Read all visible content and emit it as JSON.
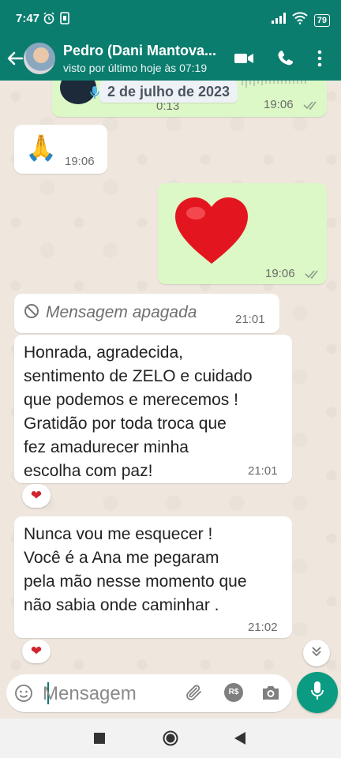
{
  "status_bar": {
    "time": "7:47",
    "battery": "79"
  },
  "header": {
    "contact_name": "Pedro (Dani Mantova...",
    "last_seen": "visto por último hoje às 07:19"
  },
  "chat": {
    "date_chip": "2 de julho de 2023",
    "top_bubble": {
      "duration": "0:13",
      "time": "19:06"
    },
    "messages": [
      {
        "emoji": "🙏",
        "time": "19:06"
      },
      {
        "emoji": "❤️",
        "time": "19:06"
      },
      {
        "deleted_text": "Mensagem apagada",
        "time": "21:01"
      },
      {
        "lines": [
          "Honrada, agradecida,",
          "sentimento de ZELO e cuidado",
          "que podemos e merecemos !",
          "Gratidão por toda troca que",
          "fez amadurecer minha",
          "escolha com paz!"
        ],
        "time": "21:01",
        "reaction": "❤"
      },
      {
        "lines": [
          "Nunca vou me esquecer !",
          "Você é a Ana me pegaram",
          "pela mão nesse momento que",
          "não sabia onde caminhar ."
        ],
        "time": "21:02",
        "reaction": "❤"
      }
    ]
  },
  "composer": {
    "placeholder": "Mensagem",
    "currency_label": "R$"
  },
  "colors": {
    "header": "#0b7d6f",
    "outgoing": "#dcf8c6",
    "incoming": "#ffffff",
    "accent": "#0a9b82"
  }
}
